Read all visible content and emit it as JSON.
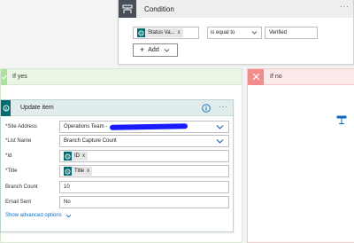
{
  "condition": {
    "title": "Condition",
    "more": "···",
    "left_token": "Status Va...",
    "left_token_remove": "x",
    "operator": "is equal to",
    "value": "Verified",
    "add_label": "Add"
  },
  "branches": {
    "yes_title": "If yes",
    "no_title": "If no"
  },
  "update_item": {
    "title": "Update item",
    "more": "···",
    "fields": {
      "site_address": {
        "label": "*Site Address",
        "value": "Operations Team -"
      },
      "list_name": {
        "label": "*List Name",
        "value": "Branch Capture Count"
      },
      "id": {
        "label": "*Id",
        "token": "ID",
        "remove": "x"
      },
      "title": {
        "label": "*Title",
        "token": "Title",
        "remove": "x"
      },
      "branch_count": {
        "label": "Branch Count",
        "value": "10"
      },
      "email_sent": {
        "label": "Email Sent",
        "value": "No"
      }
    },
    "advanced_link": "Show advanced options"
  },
  "colors": {
    "sharepoint": "#036c70",
    "yes_accent": "#aedfa0",
    "no_accent": "#f28c8c",
    "condition_icon_bg": "#484f58",
    "link": "#0f6cbd",
    "redaction": "#1a1aff"
  },
  "icons": {
    "condition": "condition-icon",
    "sharepoint": "sharepoint-icon",
    "check": "check-icon",
    "close": "close-icon",
    "info": "info-icon",
    "chevron": "chevron-down-icon",
    "action": "action-icon"
  }
}
